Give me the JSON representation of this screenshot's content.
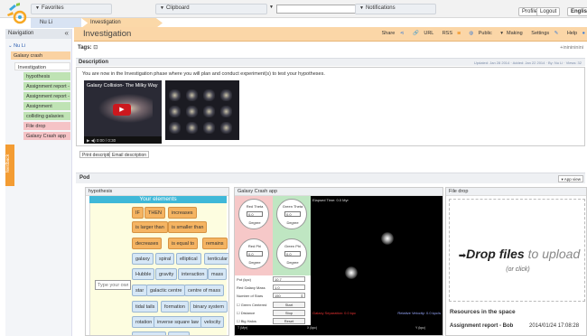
{
  "topbar": {
    "favorites": "Favorites",
    "clipboard": "Clipboard",
    "search_placeholder": "",
    "notifications": "Notifications",
    "profile": "Profile",
    "logout": "Logout",
    "language": "English"
  },
  "breadcrumb": [
    "Nu Li",
    "Investigation"
  ],
  "nav": {
    "title": "Navigation",
    "collapse": "«",
    "items": [
      {
        "label": "Nu Li"
      },
      {
        "label": "Galaxy crash"
      },
      {
        "label": "Investigation"
      },
      {
        "label": "hypothesis"
      },
      {
        "label": "Assignment report -"
      },
      {
        "label": "Assignment report -"
      },
      {
        "label": "Assignment"
      },
      {
        "label": "colliding galaxies"
      },
      {
        "label": "File drop"
      },
      {
        "label": "Galaxy Crash app"
      }
    ],
    "feedback": "feedback"
  },
  "header": {
    "title": "Investigation",
    "toolbar": [
      "Share",
      "URL",
      "RSS",
      "Public",
      "Making",
      "Settings",
      "Help"
    ]
  },
  "tags_label": "Tags:",
  "wiki_badge": "+ininininini",
  "description": {
    "label": "Description",
    "meta": "Updated: Jan 28 2014  ·  Added: Jan 22 2014  ·  By: Nu Li  ·  Views: 32",
    "text": "You are now in the Investigation phase where you will plan and conduct experiment(s) to test your hypotheses.",
    "video_title": "Galaxy Collision- The Milky Way",
    "video_time": "0:00 / 0:30"
  },
  "buttons": {
    "print": "Print description",
    "email": "Email description",
    "toggle_view": "▾ App view"
  },
  "pod_label": "Pod",
  "hypothesis": {
    "panel_title": "hypothesis",
    "elements_title": "Your elements",
    "input_placeholder": "Type your own!",
    "chips": [
      "IF",
      "THEN",
      "increases",
      "is larger than",
      "is smaller than",
      "decreases",
      "is equal to",
      "remains",
      "galaxy",
      "spiral",
      "elliptical",
      "lenticular",
      "Hubble",
      "gravity",
      "interaction",
      "mass",
      "star",
      "galactic centre",
      "centre of mass",
      "tidal tails",
      "formation",
      "binary system",
      "rotation",
      "inverse square law",
      "velocity",
      "acceleration",
      "friction"
    ]
  },
  "galaxy_app": {
    "panel_title": "Galaxy Crash app",
    "dials": [
      {
        "title": "Red Theta",
        "value": "0.0",
        "unit": "Degree"
      },
      {
        "title": "Green Theta",
        "value": "0.0",
        "unit": "Degree"
      },
      {
        "title": "Red Phi",
        "value": "0.0",
        "unit": "Degree"
      },
      {
        "title": "Green Phi",
        "value": "0.0",
        "unit": "Degree"
      }
    ],
    "rows": [
      {
        "label": "Pot (kpc)",
        "value": "10.7"
      },
      {
        "label": "Red Galaxy Mass",
        "value": "1.0"
      },
      {
        "label": "Number of Stars",
        "value": "150"
      }
    ],
    "buttons": [
      {
        "label": "Green Centered",
        "action": "Start"
      },
      {
        "label": "Distance",
        "action": "Stop"
      },
      {
        "label": "Big Halos",
        "action": "Reset"
      }
    ],
    "sim_time": "Elapsed Time: 0.0 Myr",
    "separation": "Galaxy Separation: 0.0 kpc",
    "rel_velocity": "Relative Velocity: 0.0 kpc/s",
    "table_header": [
      "T (Myr)",
      "X (kpc)",
      "Y (kpc)"
    ]
  },
  "file_drop": {
    "panel_title": "File drop",
    "drop_bold": "Drop files",
    "drop_light": "to upload",
    "drop_sub": "(or click)",
    "resources_title": "Resources in the space",
    "resource_name": "Assignment report - Bob",
    "resource_date": "2014/01/24 17:08:28"
  }
}
